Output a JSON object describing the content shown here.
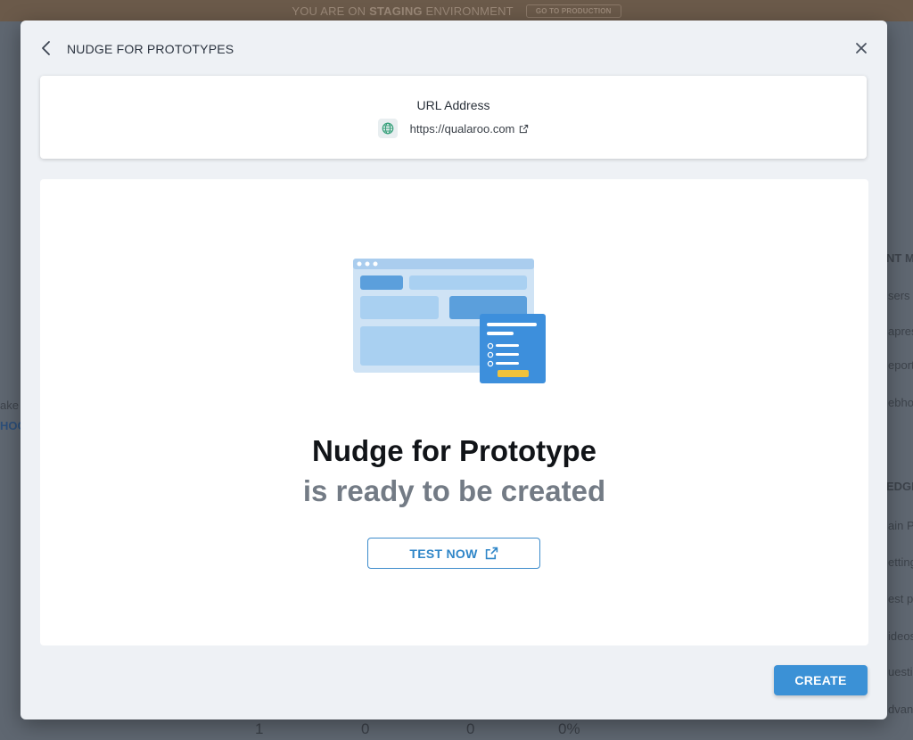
{
  "background": {
    "staging_prefix": "YOU ARE ON",
    "staging_env": "STAGING",
    "staging_suffix": "ENVIRONMENT",
    "go_to_production": "GO TO PRODUCTION",
    "right_panel": {
      "heading1": "NT MA",
      "items1": [
        "sers",
        "apres",
        "eport",
        "ebho"
      ],
      "heading2": "EDGE",
      "items2": [
        "ain P",
        "etting",
        "est p",
        "ideos",
        "uestic",
        "dvanc"
      ]
    },
    "left_fragments": [
      "ake",
      "HOO"
    ],
    "stats_row": [
      "1",
      "0",
      "0",
      "0%"
    ]
  },
  "modal": {
    "title": "NUDGE FOR PROTOTYPES",
    "back_icon": "chevron-left-icon",
    "close_icon": "close-icon",
    "url_card": {
      "label": "URL Address",
      "url": "https://qualaroo.com",
      "globe_icon": "globe-icon",
      "external_icon": "external-link-icon"
    },
    "content": {
      "illustration": "prototype-nudge-illustration",
      "headline": "Nudge for Prototype",
      "subline": "is ready to be created",
      "test_button": "TEST NOW"
    },
    "create_button": "CREATE"
  },
  "colors": {
    "accent": "#3b91d6",
    "test_button_text": "#2f86c8",
    "subline": "#737b85",
    "modal_bg": "#eef1f5",
    "staging_bar": "#6b5a4a"
  }
}
